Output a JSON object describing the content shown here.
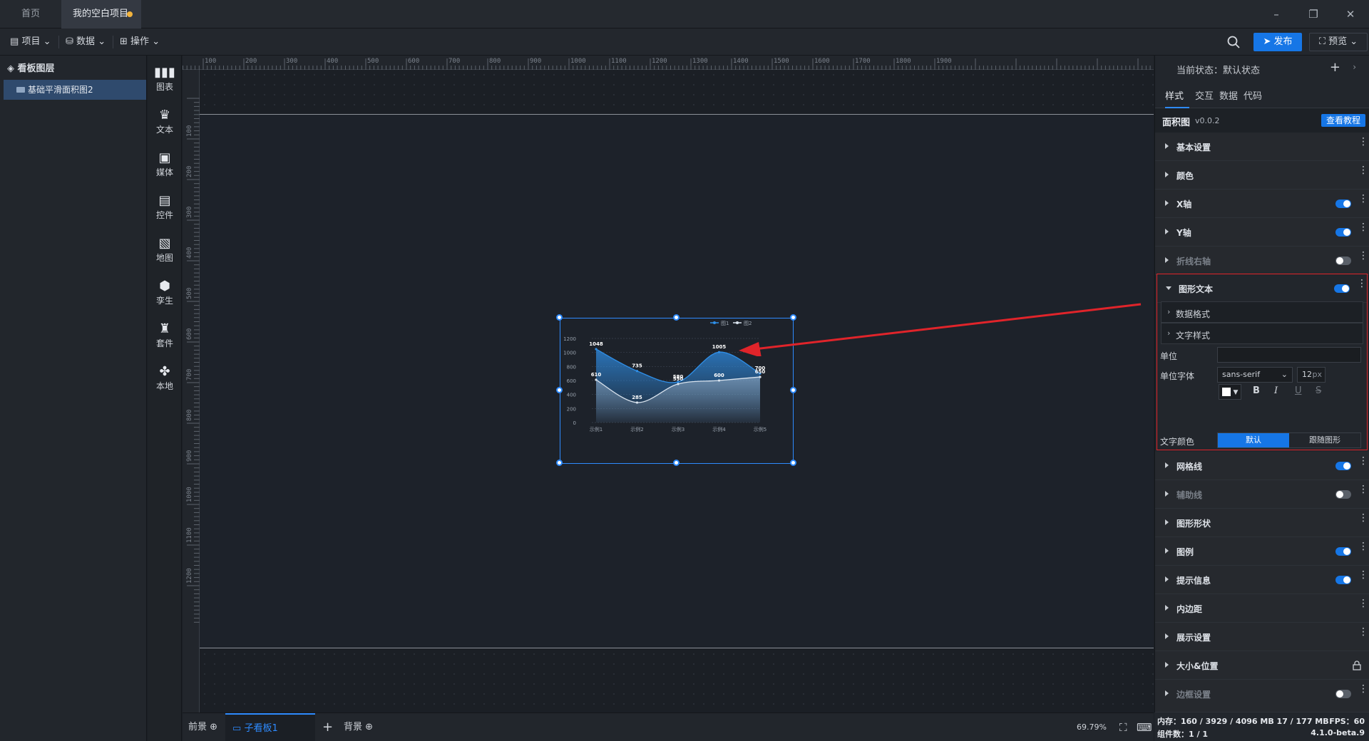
{
  "titlebar": {
    "tabs": [
      "首页",
      "我的空白项目"
    ]
  },
  "menubar": {
    "items": [
      "项目",
      "数据",
      "操作"
    ],
    "publish": "发布",
    "preview": "预览"
  },
  "layers": {
    "title": "看板图层",
    "items": [
      "基础平滑面积图2"
    ]
  },
  "components": [
    "图表",
    "文本",
    "媒体",
    "控件",
    "地图",
    "孪生",
    "套件",
    "本地"
  ],
  "ruler": {
    "h": [
      "100",
      "200",
      "300",
      "400",
      "500",
      "600",
      "700",
      "800",
      "900",
      "1000",
      "1100",
      "1200",
      "1300",
      "1400",
      "1500",
      "1600",
      "1700",
      "1800",
      "1900"
    ],
    "v": [
      "100",
      "200",
      "300",
      "400",
      "500",
      "600",
      "700",
      "800",
      "900",
      "1000",
      "1100",
      "1200"
    ]
  },
  "chart_data": {
    "type": "area",
    "categories": [
      "示例1",
      "示例2",
      "示例3",
      "示例4",
      "示例5"
    ],
    "series": [
      {
        "name": "图1",
        "values": [
          1048,
          735,
          580,
          1005,
          700
        ],
        "color": "#2f8fe8"
      },
      {
        "name": "图2",
        "values": [
          610,
          285,
          550,
          600,
          650
        ],
        "color": "#d9e3ee"
      }
    ],
    "yticks": [
      "0",
      "200",
      "400",
      "600",
      "800",
      "1000",
      "1200"
    ],
    "ylim": [
      0,
      1200
    ],
    "grid": true,
    "legend": "top-right"
  },
  "bottombar": {
    "front": "前景",
    "board": "子看板1",
    "back": "背景",
    "zoom": "69.79%"
  },
  "rpanel": {
    "state": "当前状态：默认状态",
    "tabs": [
      "样式",
      "交互",
      "数据",
      "代码"
    ],
    "comp_name": "面积图",
    "comp_version": "v0.0.2",
    "tutorial": "查看教程",
    "sections_top": [
      {
        "label": "基本设置",
        "toggle": null
      },
      {
        "label": "颜色",
        "toggle": null
      },
      {
        "label": "X轴",
        "toggle": "on"
      },
      {
        "label": "Y轴",
        "toggle": "on"
      },
      {
        "label": "折线右轴",
        "toggle": "off"
      }
    ],
    "expanded": {
      "label": "图形文本",
      "sub1": "数据格式",
      "sub2": "文字样式",
      "unit_label": "单位",
      "unit_value": "",
      "unit_font_label": "单位字体",
      "font_value": "sans-serif",
      "size_value": "12",
      "size_unit": "px",
      "text_color_label": "文字颜色",
      "color_default": "默认",
      "color_follow": "跟随图形"
    },
    "sections_bottom": [
      {
        "label": "网格线",
        "toggle": "on"
      },
      {
        "label": "辅助线",
        "toggle": "off"
      },
      {
        "label": "图形形状",
        "toggle": null
      },
      {
        "label": "图例",
        "toggle": "on"
      },
      {
        "label": "提示信息",
        "toggle": "on"
      },
      {
        "label": "内边距",
        "toggle": null
      },
      {
        "label": "展示设置",
        "toggle": null
      },
      {
        "label": "大小&位置",
        "toggle": "lock"
      },
      {
        "label": "边框设置",
        "toggle": "off"
      }
    ]
  },
  "status": {
    "memory": "内存：160 / 3929 / 4096 MB  17 / 177 MB",
    "fps": "FPS：60",
    "count": "组件数：1 / 1",
    "version": "4.1.0-beta.9"
  }
}
